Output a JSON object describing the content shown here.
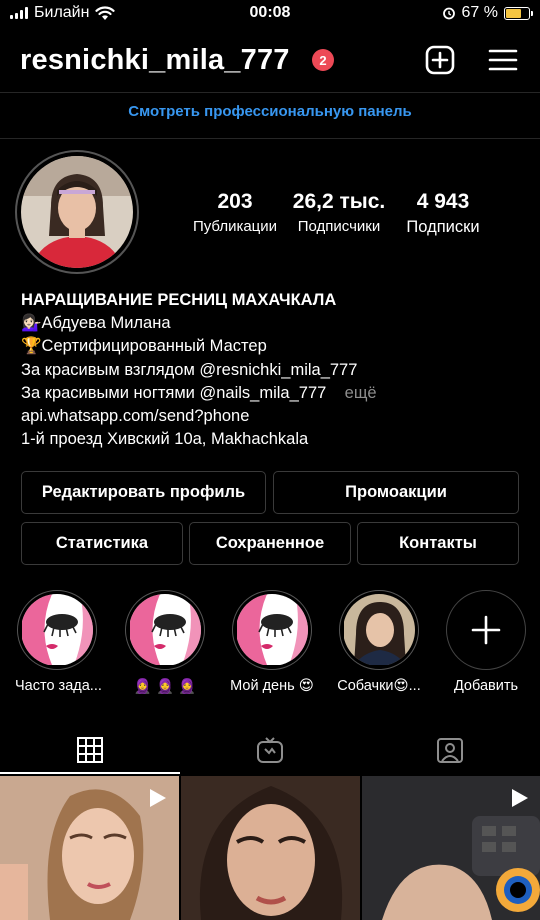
{
  "status_bar": {
    "carrier": "Билайн",
    "time": "00:08",
    "battery": "67 %",
    "battery_level": 0.67
  },
  "header": {
    "username": "resnichki_mila_777",
    "notifications": "2"
  },
  "pro_panel": "Смотреть профессиональную панель",
  "stats": [
    {
      "value": "203",
      "label": "Публикации"
    },
    {
      "value": "26,2 тыс.",
      "label": "Подписчики"
    },
    {
      "value": "4 943",
      "label": "Подписки"
    }
  ],
  "bio": {
    "name": "НАРАЩИВАНИЕ РЕСНИЦ  МАХАЧКАЛА",
    "line1": "Абдуева Милана",
    "line2": "Сертифицированный Мастер",
    "line3": "За красивым взглядом  @resnichki_mila_777",
    "line4": "За красивыми ногтями  @nails_mila_777",
    "more": "ещё",
    "link": "api.whatsapp.com/send?phone",
    "address": "1-й проезд Хивский 10а, Makhachkala"
  },
  "buttons": {
    "edit_profile": "Редактировать профиль",
    "promotions": "Промоакции",
    "statistics": "Статистика",
    "saved": "Сохраненное",
    "contacts": "Контакты"
  },
  "highlights": [
    {
      "label": "Часто зада..."
    },
    {
      "label": "🧕 🧕 🧕"
    },
    {
      "label": "Мой день 😍"
    },
    {
      "label": "Собачки😍..."
    },
    {
      "label": "Добавить"
    }
  ],
  "colors": {
    "accent_blue": "#3897f0",
    "badge_red": "#ed4956",
    "battery_yellow": "#f5c542",
    "highlight_pink": "#e84b8a"
  }
}
